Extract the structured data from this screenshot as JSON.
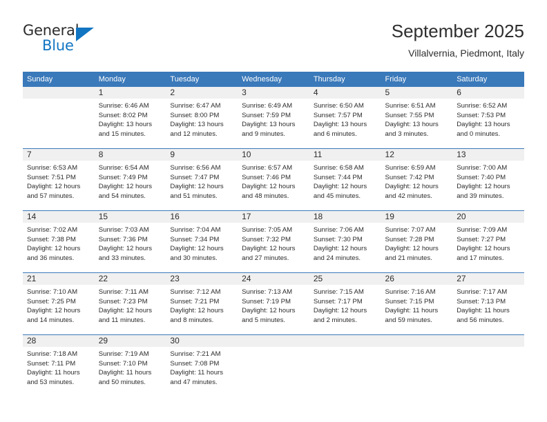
{
  "brand": {
    "name_part1": "General",
    "name_part2": "Blue",
    "accent_color": "#1175c2"
  },
  "header": {
    "title": "September 2025",
    "location": "Villalvernia, Piedmont, Italy"
  },
  "theme": {
    "header_row_bg": "#3a79ba",
    "daynum_bg": "#f0f0f0",
    "grid_line": "#3a79ba",
    "text": "#2b2b2b"
  },
  "calendar": {
    "weekday_headers": [
      "Sunday",
      "Monday",
      "Tuesday",
      "Wednesday",
      "Thursday",
      "Friday",
      "Saturday"
    ],
    "labels": {
      "sunrise": "Sunrise:",
      "sunset": "Sunset:",
      "daylight": "Daylight:"
    },
    "weeks": [
      [
        {
          "day": "",
          "sunrise": "",
          "sunset": "",
          "daylight": "",
          "empty": true
        },
        {
          "day": "1",
          "sunrise": "Sunrise: 6:46 AM",
          "sunset": "Sunset: 8:02 PM",
          "daylight": "Daylight: 13 hours and 15 minutes."
        },
        {
          "day": "2",
          "sunrise": "Sunrise: 6:47 AM",
          "sunset": "Sunset: 8:00 PM",
          "daylight": "Daylight: 13 hours and 12 minutes."
        },
        {
          "day": "3",
          "sunrise": "Sunrise: 6:49 AM",
          "sunset": "Sunset: 7:59 PM",
          "daylight": "Daylight: 13 hours and 9 minutes."
        },
        {
          "day": "4",
          "sunrise": "Sunrise: 6:50 AM",
          "sunset": "Sunset: 7:57 PM",
          "daylight": "Daylight: 13 hours and 6 minutes."
        },
        {
          "day": "5",
          "sunrise": "Sunrise: 6:51 AM",
          "sunset": "Sunset: 7:55 PM",
          "daylight": "Daylight: 13 hours and 3 minutes."
        },
        {
          "day": "6",
          "sunrise": "Sunrise: 6:52 AM",
          "sunset": "Sunset: 7:53 PM",
          "daylight": "Daylight: 13 hours and 0 minutes."
        }
      ],
      [
        {
          "day": "7",
          "sunrise": "Sunrise: 6:53 AM",
          "sunset": "Sunset: 7:51 PM",
          "daylight": "Daylight: 12 hours and 57 minutes."
        },
        {
          "day": "8",
          "sunrise": "Sunrise: 6:54 AM",
          "sunset": "Sunset: 7:49 PM",
          "daylight": "Daylight: 12 hours and 54 minutes."
        },
        {
          "day": "9",
          "sunrise": "Sunrise: 6:56 AM",
          "sunset": "Sunset: 7:47 PM",
          "daylight": "Daylight: 12 hours and 51 minutes."
        },
        {
          "day": "10",
          "sunrise": "Sunrise: 6:57 AM",
          "sunset": "Sunset: 7:46 PM",
          "daylight": "Daylight: 12 hours and 48 minutes."
        },
        {
          "day": "11",
          "sunrise": "Sunrise: 6:58 AM",
          "sunset": "Sunset: 7:44 PM",
          "daylight": "Daylight: 12 hours and 45 minutes."
        },
        {
          "day": "12",
          "sunrise": "Sunrise: 6:59 AM",
          "sunset": "Sunset: 7:42 PM",
          "daylight": "Daylight: 12 hours and 42 minutes."
        },
        {
          "day": "13",
          "sunrise": "Sunrise: 7:00 AM",
          "sunset": "Sunset: 7:40 PM",
          "daylight": "Daylight: 12 hours and 39 minutes."
        }
      ],
      [
        {
          "day": "14",
          "sunrise": "Sunrise: 7:02 AM",
          "sunset": "Sunset: 7:38 PM",
          "daylight": "Daylight: 12 hours and 36 minutes."
        },
        {
          "day": "15",
          "sunrise": "Sunrise: 7:03 AM",
          "sunset": "Sunset: 7:36 PM",
          "daylight": "Daylight: 12 hours and 33 minutes."
        },
        {
          "day": "16",
          "sunrise": "Sunrise: 7:04 AM",
          "sunset": "Sunset: 7:34 PM",
          "daylight": "Daylight: 12 hours and 30 minutes."
        },
        {
          "day": "17",
          "sunrise": "Sunrise: 7:05 AM",
          "sunset": "Sunset: 7:32 PM",
          "daylight": "Daylight: 12 hours and 27 minutes."
        },
        {
          "day": "18",
          "sunrise": "Sunrise: 7:06 AM",
          "sunset": "Sunset: 7:30 PM",
          "daylight": "Daylight: 12 hours and 24 minutes."
        },
        {
          "day": "19",
          "sunrise": "Sunrise: 7:07 AM",
          "sunset": "Sunset: 7:28 PM",
          "daylight": "Daylight: 12 hours and 21 minutes."
        },
        {
          "day": "20",
          "sunrise": "Sunrise: 7:09 AM",
          "sunset": "Sunset: 7:27 PM",
          "daylight": "Daylight: 12 hours and 17 minutes."
        }
      ],
      [
        {
          "day": "21",
          "sunrise": "Sunrise: 7:10 AM",
          "sunset": "Sunset: 7:25 PM",
          "daylight": "Daylight: 12 hours and 14 minutes."
        },
        {
          "day": "22",
          "sunrise": "Sunrise: 7:11 AM",
          "sunset": "Sunset: 7:23 PM",
          "daylight": "Daylight: 12 hours and 11 minutes."
        },
        {
          "day": "23",
          "sunrise": "Sunrise: 7:12 AM",
          "sunset": "Sunset: 7:21 PM",
          "daylight": "Daylight: 12 hours and 8 minutes."
        },
        {
          "day": "24",
          "sunrise": "Sunrise: 7:13 AM",
          "sunset": "Sunset: 7:19 PM",
          "daylight": "Daylight: 12 hours and 5 minutes."
        },
        {
          "day": "25",
          "sunrise": "Sunrise: 7:15 AM",
          "sunset": "Sunset: 7:17 PM",
          "daylight": "Daylight: 12 hours and 2 minutes."
        },
        {
          "day": "26",
          "sunrise": "Sunrise: 7:16 AM",
          "sunset": "Sunset: 7:15 PM",
          "daylight": "Daylight: 11 hours and 59 minutes."
        },
        {
          "day": "27",
          "sunrise": "Sunrise: 7:17 AM",
          "sunset": "Sunset: 7:13 PM",
          "daylight": "Daylight: 11 hours and 56 minutes."
        }
      ],
      [
        {
          "day": "28",
          "sunrise": "Sunrise: 7:18 AM",
          "sunset": "Sunset: 7:11 PM",
          "daylight": "Daylight: 11 hours and 53 minutes."
        },
        {
          "day": "29",
          "sunrise": "Sunrise: 7:19 AM",
          "sunset": "Sunset: 7:10 PM",
          "daylight": "Daylight: 11 hours and 50 minutes."
        },
        {
          "day": "30",
          "sunrise": "Sunrise: 7:21 AM",
          "sunset": "Sunset: 7:08 PM",
          "daylight": "Daylight: 11 hours and 47 minutes."
        },
        {
          "day": "",
          "sunrise": "",
          "sunset": "",
          "daylight": "",
          "empty": true
        },
        {
          "day": "",
          "sunrise": "",
          "sunset": "",
          "daylight": "",
          "empty": true
        },
        {
          "day": "",
          "sunrise": "",
          "sunset": "",
          "daylight": "",
          "empty": true
        },
        {
          "day": "",
          "sunrise": "",
          "sunset": "",
          "daylight": "",
          "empty": true
        }
      ]
    ]
  }
}
